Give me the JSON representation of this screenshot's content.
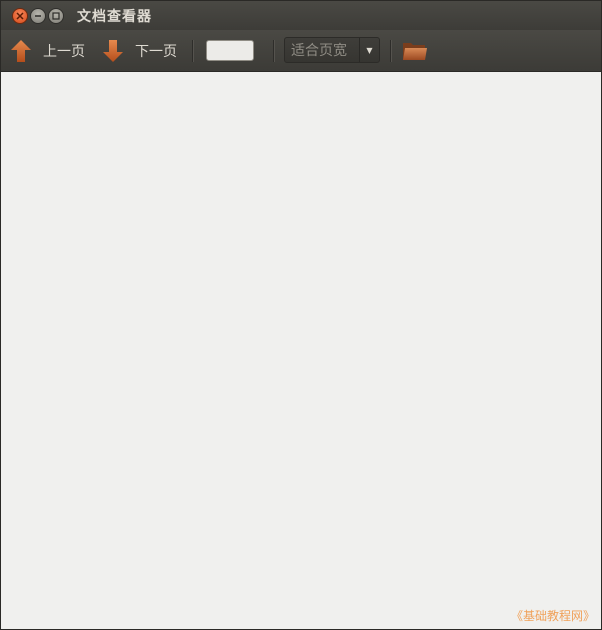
{
  "window": {
    "title": "文档查看器"
  },
  "toolbar": {
    "prev_label": "上一页",
    "next_label": "下一页",
    "page_entry_value": "",
    "zoom_selected": "适合页宽",
    "prev_icon": "arrow-up-icon",
    "next_icon": "arrow-down-icon",
    "open_icon": "folder-icon"
  },
  "watermark": {
    "text": "《基础教程网》"
  },
  "colors": {
    "titlebar": "#3d3c38",
    "close_button": "#e05a25",
    "arrow_icon": "#d86a33",
    "content_bg": "#f0f0ee",
    "watermark": "#f0a15a"
  }
}
